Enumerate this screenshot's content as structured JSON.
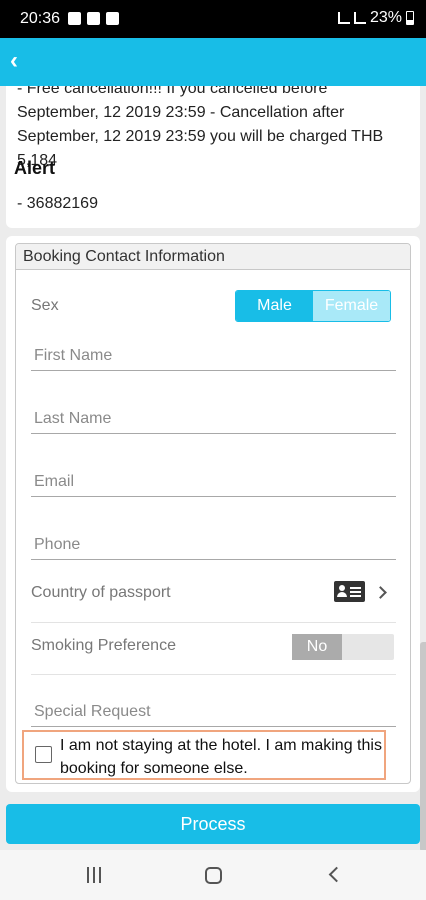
{
  "status_bar": {
    "time": "20:36",
    "battery": "23%"
  },
  "policy": {
    "text": "- Free cancellation!!! If you cancelled before September, 12 2019 23:59 - Cancellation after September, 12 2019 23:59 you will be charged THB 5,184",
    "alert_title": "Alert",
    "alert_value": "- 36882169"
  },
  "contact": {
    "header": "Booking Contact Information",
    "sex_label": "Sex",
    "sex_options": [
      "Male",
      "Female"
    ],
    "sex_selected": "Male",
    "first_name_placeholder": "First Name",
    "last_name_placeholder": "Last Name",
    "email_placeholder": "Email",
    "phone_placeholder": "Phone",
    "country_label": "Country of passport",
    "smoking_label": "Smoking Preference",
    "smoking_value": "No",
    "special_request_placeholder": "Special Request",
    "someone_else_text": "I am not staying at the hotel. I am making this booking for someone else.",
    "someone_else_checked": false
  },
  "process_label": "Process",
  "colors": {
    "accent": "#18bde7",
    "highlight_border": "#f0a57e"
  },
  "icons": [
    "back-arrow-icon",
    "passport-card-icon",
    "chevron-right-icon",
    "nav-recent-icon",
    "nav-home-icon",
    "nav-back-icon"
  ]
}
